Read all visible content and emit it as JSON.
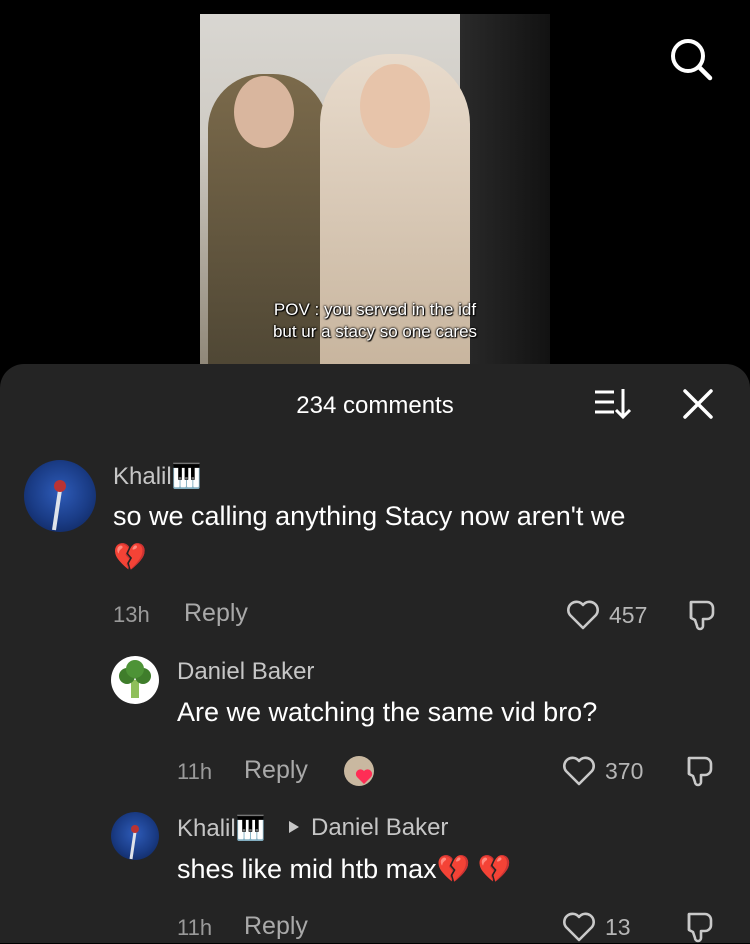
{
  "video": {
    "caption_line1": "POV : you served in the idf",
    "caption_line2": "but ur a stacy so one cares"
  },
  "comments_header": {
    "count_label": "234 comments"
  },
  "comments": [
    {
      "author": "Khalil🎹",
      "text": "so we calling anything Stacy now aren't we",
      "emoji_line": "💔",
      "time": "13h",
      "reply_label": "Reply",
      "likes": "457"
    },
    {
      "author": "Daniel Baker",
      "text": "Are we watching the same vid bro?",
      "time": "11h",
      "reply_label": "Reply",
      "likes": "370"
    },
    {
      "author": "Khalil🎹",
      "reply_to": "Daniel Baker",
      "text": "shes like mid htb max💔 💔",
      "time": "11h",
      "reply_label": "Reply",
      "likes": "13"
    }
  ],
  "icons": {
    "search": "search-icon",
    "sort": "sort-icon",
    "close": "close-icon",
    "heart": "heart-icon",
    "dislike": "dislike-icon"
  },
  "colors": {
    "sheet_bg": "#242424",
    "background": "#000000"
  }
}
